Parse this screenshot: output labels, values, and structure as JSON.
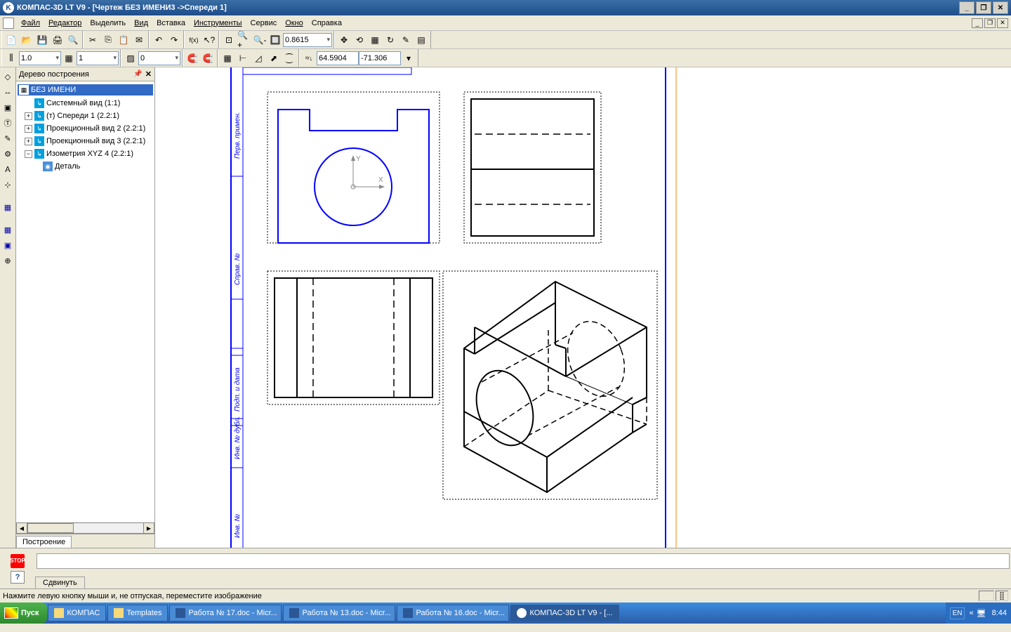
{
  "title": "КОМПАС-3D LT V9 - [Чертеж БЕЗ ИМЕНИ3 ->Спереди 1]",
  "menu": [
    "Файл",
    "Редактор",
    "Выделить",
    "Вид",
    "Вставка",
    "Инструменты",
    "Сервис",
    "Окно",
    "Справка"
  ],
  "zoom_value": "0.8615",
  "scale_value": "1.0",
  "layer_value": "1",
  "color_value": "0",
  "coord_x": "64.5904",
  "coord_y": "-71.306",
  "tree": {
    "title": "Дерево построения",
    "root": "БЕЗ ИМЕНИ",
    "items": [
      {
        "label": "Системный вид (1:1)",
        "exp": false
      },
      {
        "label": "(т) Спереди 1 (2.2:1)",
        "exp": true
      },
      {
        "label": "Проекционный вид 2 (2.2:1)",
        "exp": true
      },
      {
        "label": "Проекционный вид 3 (2.2:1)",
        "exp": true
      },
      {
        "label": "Изометрия XYZ 4 (2.2:1)",
        "exp": true
      }
    ],
    "child": "Деталь",
    "tab": "Построение"
  },
  "bottom_tab": "Сдвинуть",
  "status": "Нажмите левую кнопку мыши и, не отпуская, переместите изображение",
  "taskbar": {
    "start": "Пуск",
    "items": [
      {
        "label": "КОМПАС",
        "icon": "folder"
      },
      {
        "label": "Templates",
        "icon": "folder"
      },
      {
        "label": "Работа № 17.doc - Micr...",
        "icon": "word"
      },
      {
        "label": "Работа № 13.doc - Micr...",
        "icon": "word"
      },
      {
        "label": "Работа № 16.doc - Micr...",
        "icon": "word"
      },
      {
        "label": "КОМПАС-3D LT V9 - [...",
        "icon": "kompas",
        "active": true
      }
    ],
    "lang": "EN",
    "time": "8:44"
  }
}
